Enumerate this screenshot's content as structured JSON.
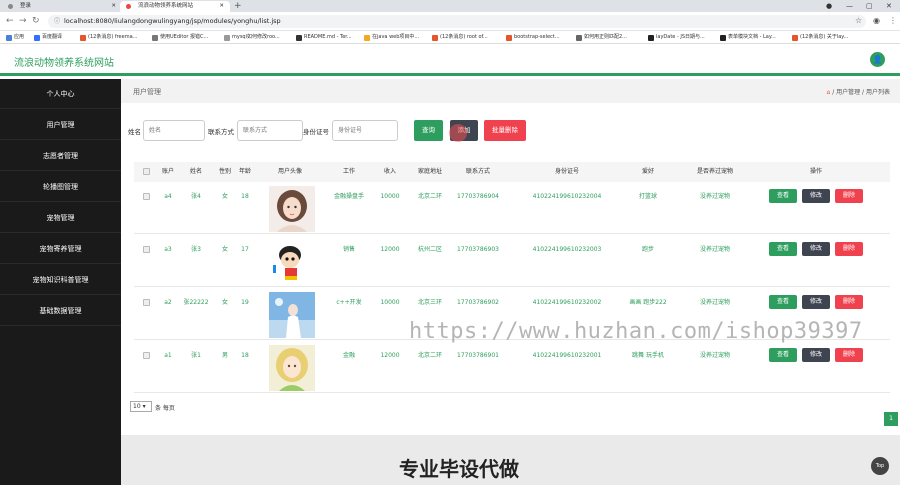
{
  "browser": {
    "tabs": [
      {
        "label": "登录",
        "active": false
      },
      {
        "label": "流浪动物领养系统网站",
        "active": true
      }
    ],
    "url": "localhost:8080/liulangdongwulingyang/jsp/modules/yonghu/list.jsp",
    "bookmarks": [
      "应用",
      "百度翻译",
      "(12条消息) freema...",
      "使用UEditor 报错C...",
      "mysql如何修改roo...",
      "README.md - Ter...",
      "在java web项目中...",
      "(12条消息) root of...",
      "bootstrap-select...",
      "如何用正则匹配2...",
      "layDate - JS日期与...",
      "表单模块文档 - Lay...",
      "(12条消息) 关于lay..."
    ]
  },
  "app": {
    "title": "流浪动物领养系统网站",
    "accent": "#2e9e5e"
  },
  "sidebar": {
    "items": [
      "个人中心",
      "用户管理",
      "志愿者管理",
      "轮播图管理",
      "宠物管理",
      "宠物寄养管理",
      "宠物知识科普管理",
      "基础数据管理"
    ]
  },
  "page": {
    "title": "用户管理",
    "breadcrumb": [
      "用户管理",
      "用户列表"
    ]
  },
  "filters": {
    "name_label": "姓名",
    "name_placeholder": "姓名",
    "phone_label": "联系方式",
    "phone_placeholder": "联系方式",
    "id_label": "身份证号",
    "id_placeholder": "身份证号"
  },
  "actions": {
    "search": "查询",
    "add": "添加",
    "batch_delete": "批量删除"
  },
  "table": {
    "headers": [
      "账户",
      "姓名",
      "性别",
      "年龄",
      "用户头像",
      "工作",
      "收入",
      "家庭地址",
      "联系方式",
      "身份证号",
      "爱好",
      "是否养过宠物",
      "操作"
    ],
    "rows": [
      {
        "account": "a4",
        "name": "张4",
        "gender": "女",
        "age": "18",
        "job": "金融操盘手",
        "income": "10000",
        "address": "北京二环",
        "phone": "17703786904",
        "idcard": "410224199610232004",
        "hobby": "打篮球",
        "pet": "没养过宠物"
      },
      {
        "account": "a3",
        "name": "张3",
        "gender": "女",
        "age": "17",
        "job": "销售",
        "income": "12000",
        "address": "杭州二区",
        "phone": "17703786903",
        "idcard": "410224199610232003",
        "hobby": "跑步",
        "pet": "没养过宠物"
      },
      {
        "account": "a2",
        "name": "张22222",
        "gender": "女",
        "age": "19",
        "job": "c++开发",
        "income": "10000",
        "address": "北京三环",
        "phone": "17703786902",
        "idcard": "410224199610232002",
        "hobby": "画画 跑步222",
        "pet": "没养过宠物"
      },
      {
        "account": "a1",
        "name": "张1",
        "gender": "男",
        "age": "18",
        "job": "金融",
        "income": "12000",
        "address": "北京二环",
        "phone": "17703786901",
        "idcard": "410224199610232001",
        "hobby": "跳舞 玩手机",
        "pet": "没养过宠物"
      }
    ],
    "row_actions": {
      "view": "查看",
      "edit": "修改",
      "delete": "删除"
    }
  },
  "pagination": {
    "page_size": "10",
    "page_size_label": "条 每页",
    "current_page": "1"
  },
  "overlay": {
    "promo": "专业毕设代做",
    "watermark": "https://www.huzhan.com/ishop39397",
    "top_button": "Top"
  }
}
